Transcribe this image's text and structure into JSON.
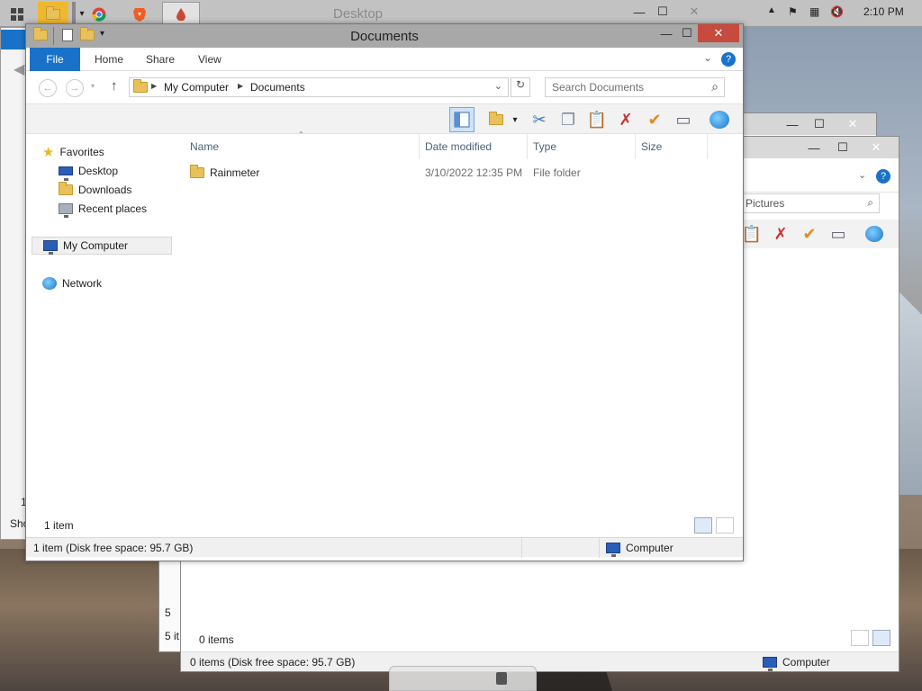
{
  "taskbar": {
    "title": "Desktop",
    "time": "2:10 PM",
    "icons": [
      "windows-start-icon",
      "file-explorer-icon",
      "chrome-icon",
      "brave-icon",
      "drop-app-icon"
    ]
  },
  "back_window": {
    "search_placeholder": "Pictures",
    "status_items": "0 items",
    "status_disk": "0 items (Disk free space: 95.7 GB)",
    "status_location": "Computer",
    "left_edge_a": "5",
    "left_edge_b": "5 it"
  },
  "left_window": {
    "left_edge_count": "1",
    "left_edge_label": "Sho"
  },
  "main_window": {
    "title": "Documents",
    "tabs": [
      "File",
      "Home",
      "Share",
      "View"
    ],
    "breadcrumb": [
      "My Computer",
      "Documents"
    ],
    "search_placeholder": "Search Documents",
    "nav": {
      "favorites": "Favorites",
      "desktop": "Desktop",
      "downloads": "Downloads",
      "recent": "Recent places",
      "my_computer": "My Computer",
      "network": "Network"
    },
    "columns": [
      "Name",
      "Date modified",
      "Type",
      "Size"
    ],
    "rows": [
      {
        "name": "Rainmeter",
        "date": "3/10/2022 12:35 PM",
        "type": "File folder",
        "size": ""
      }
    ],
    "item_count": "1 item",
    "status_disk": "1 item (Disk free space: 95.7 GB)",
    "status_location": "Computer"
  }
}
